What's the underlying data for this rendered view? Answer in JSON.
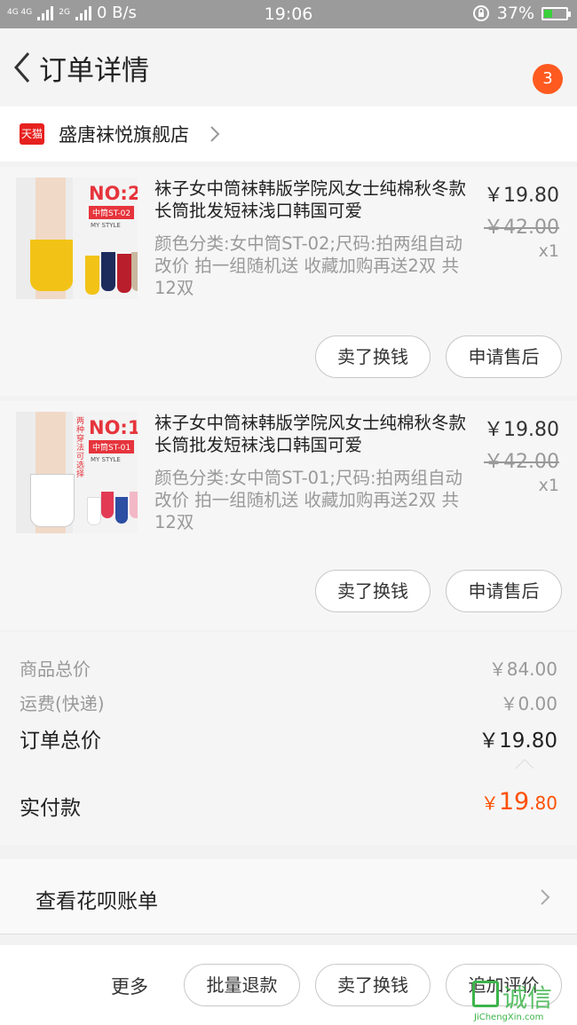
{
  "status_bar": {
    "network": "4G 4G",
    "network2": "2G",
    "speed": "0 B/s",
    "time": "19:06",
    "battery": "37%",
    "battery_level": 0.37
  },
  "header": {
    "title": "订单详情",
    "badge": "3"
  },
  "shop": {
    "logo": "天猫",
    "name": "盛唐袜悦旗舰店"
  },
  "items": [
    {
      "title": "袜子女中筒袜韩版学院风女士纯棉秋冬款长筒批发短袜浅口韩国可爱",
      "spec": "颜色分类:女中筒ST-02;尺码:拍两组自动改价 拍一组随机送 收藏加购再送2双 共12双",
      "price": "￥19.80",
      "original_price": "￥42.00",
      "qty": "x1",
      "thumb_no": "NO:2",
      "thumb_tag": "中筒ST-02",
      "thumb_style": "MY STYLE",
      "btn_sell": "卖了换钱",
      "btn_after_sale": "申请售后"
    },
    {
      "title": "袜子女中筒袜韩版学院风女士纯棉秋冬款长筒批发短袜浅口韩国可爱",
      "spec": "颜色分类:女中筒ST-01;尺码:拍两组自动改价 拍一组随机送 收藏加购再送2双 共12双",
      "price": "￥19.80",
      "original_price": "￥42.00",
      "qty": "x1",
      "thumb_no": "NO:1",
      "thumb_tag": "中筒ST-01",
      "thumb_style": "MY STYLE",
      "thumb_side": "两种穿法可选择",
      "btn_sell": "卖了换钱",
      "btn_after_sale": "申请售后"
    }
  ],
  "summary": {
    "goods_total_label": "商品总价",
    "goods_total_value": "￥84.00",
    "shipping_label": "运费(快递)",
    "shipping_value": "￥0.00",
    "order_total_label": "订单总价",
    "order_total_value": "￥19.80",
    "paid_label": "实付款",
    "paid_currency": "￥",
    "paid_int": "19",
    "paid_dec": ".80"
  },
  "huabei": {
    "label": "查看花呗账单"
  },
  "bottom_bar": {
    "more": "更多",
    "batch_refund": "批量退款",
    "sell": "卖了换钱",
    "add_review": "追加评价"
  },
  "watermark": {
    "main": "诚信",
    "sub": "JiChengXin.com"
  },
  "colors": {
    "accent": "#ff5a1f",
    "tmall": "#e6211f",
    "price_paid": "#ff5000"
  }
}
